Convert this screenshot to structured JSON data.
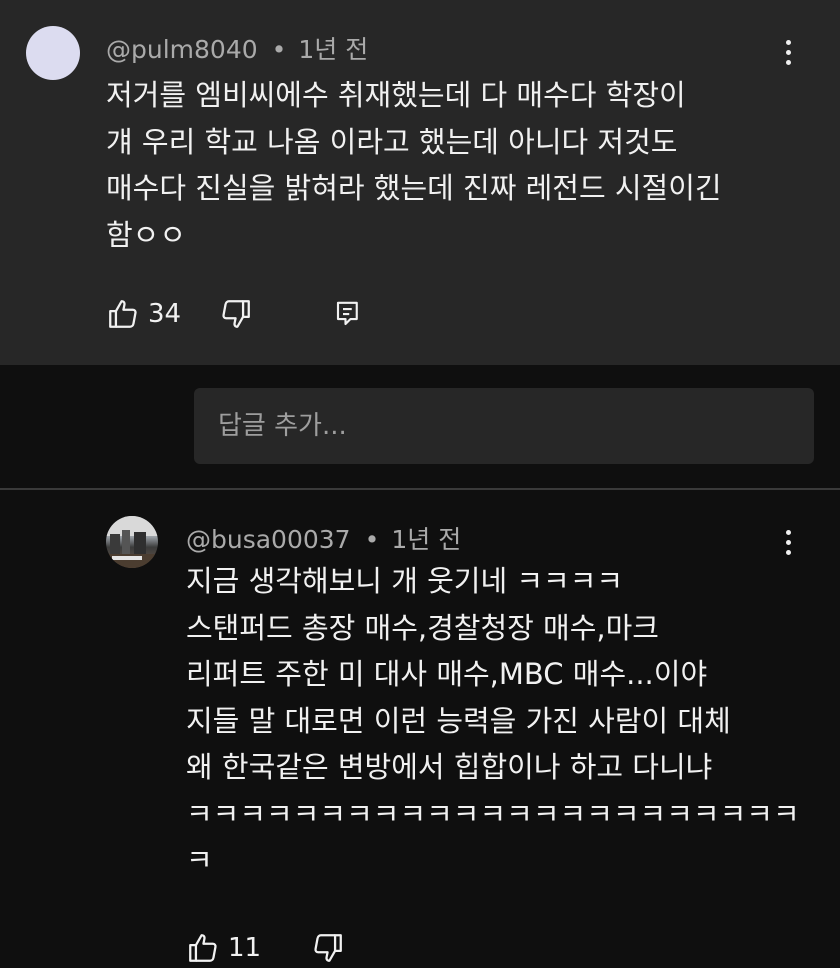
{
  "comment": {
    "author": "@pulm8040",
    "time": "1년 전",
    "text": "저거를 엠비씨에수 취재했는데 다 매수다 학장이\n걔 우리 학교 나옴 이라고 했는데 아니다 저것도\n매수다 진실을 밝혀라 했는데 진짜 레전드 시절이긴\n함ㅇㅇ",
    "likes": "34",
    "icons": [
      "thumbs-up-icon",
      "thumbs-down-icon",
      "reply-icon",
      "more-vert-icon"
    ]
  },
  "reply_input": {
    "placeholder": "답글 추가..."
  },
  "reply": {
    "author": "@busa00037",
    "time": "1년 전",
    "text": "지금 생각해보니 개 웃기네 ㅋㅋㅋㅋ\n스탠퍼드 총장 매수,경찰청장 매수,마크\n리퍼트 주한 미 대사 매수,MBC 매수...이야\n지들 말 대로면 이런 능력을 가진 사람이 대체\n왜 한국같은 변방에서 힙합이나 하고 다니냐\nㅋㅋㅋㅋㅋㅋㅋㅋㅋㅋㅋㅋㅋㅋㅋㅋㅋㅋㅋㅋㅋㅋㅋ\nㅋ",
    "likes": "11"
  }
}
